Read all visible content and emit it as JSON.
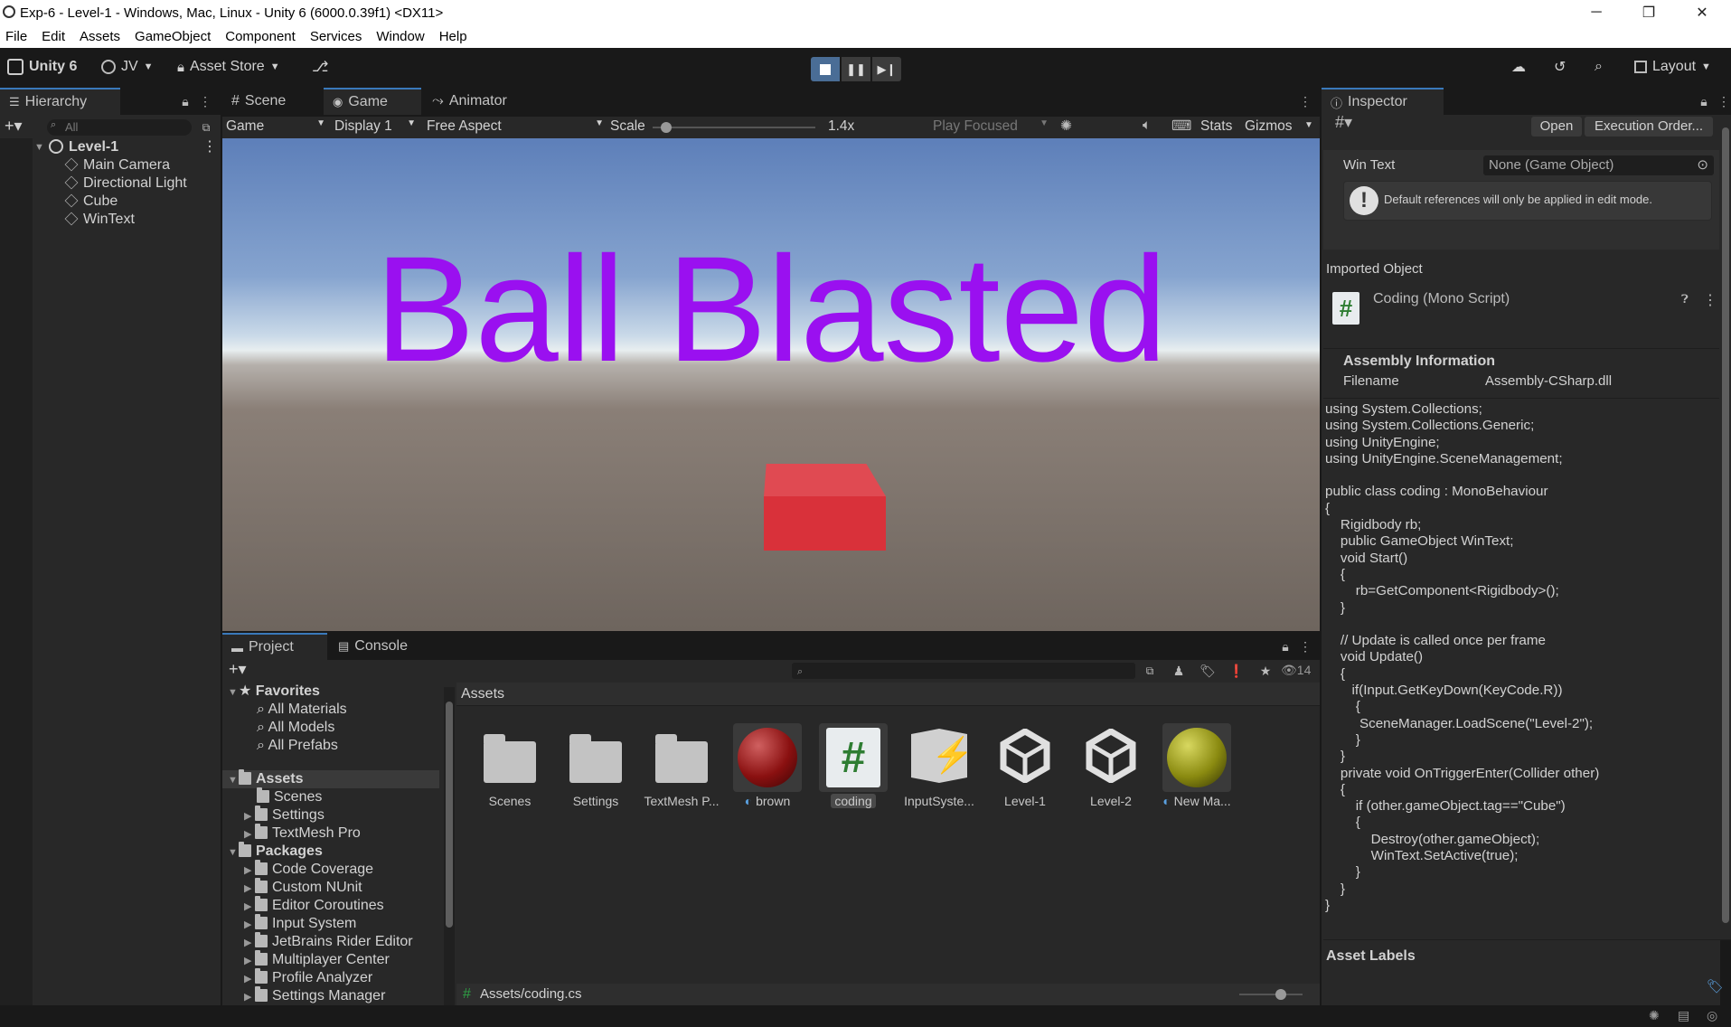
{
  "window": {
    "title": "Exp-6 - Level-1 - Windows, Mac, Linux - Unity 6 (6000.0.39f1) <DX11>",
    "minimize": "─",
    "maximize": "❐",
    "close": "✕"
  },
  "menu": [
    "File",
    "Edit",
    "Assets",
    "GameObject",
    "Component",
    "Services",
    "Window",
    "Help"
  ],
  "toolbar": {
    "unity_label": "Unity 6",
    "account": "JV",
    "asset_store": "Asset Store",
    "layout": "Layout"
  },
  "hierarchy": {
    "tab": "Hierarchy",
    "search_placeholder": "All",
    "scene": "Level-1",
    "items": [
      "Main Camera",
      "Directional Light",
      "Cube",
      "WinText"
    ]
  },
  "scene_tabs": [
    "Scene",
    "Game",
    "Animator"
  ],
  "game_bar": {
    "mode": "Game",
    "display": "Display 1",
    "aspect": "Free Aspect",
    "scale_label": "Scale",
    "scale_value": "1.4x",
    "scale_fraction": 0.05,
    "play_focused": "Play Focused",
    "stats": "Stats",
    "gizmos": "Gizmos"
  },
  "game_view": {
    "banner_text": "Ball Blasted",
    "banner_color": "#9a10f0",
    "cube_color": "#d9313a"
  },
  "project": {
    "tabs": [
      "Project",
      "Console"
    ],
    "hidden_count": "14",
    "favorites_label": "Favorites",
    "favorites": [
      "All Materials",
      "All Models",
      "All Prefabs"
    ],
    "assets_label": "Assets",
    "assets_children": [
      "Scenes",
      "Settings",
      "TextMesh Pro"
    ],
    "packages_label": "Packages",
    "packages": [
      "Code Coverage",
      "Custom NUnit",
      "Editor Coroutines",
      "Input System",
      "JetBrains Rider Editor",
      "Multiplayer Center",
      "Profile Analyzer",
      "Settings Manager"
    ],
    "breadcrumb": "Assets",
    "grid_items": [
      "Scenes",
      "Settings",
      "TextMesh P...",
      "brown",
      "coding",
      "InputSyste...",
      "Level-1",
      "Level-2",
      "New Ma..."
    ],
    "footer_path": "Assets/coding.cs"
  },
  "inspector": {
    "tab": "Inspector",
    "open_button": "Open",
    "execution_order_button": "Execution Order...",
    "win_text_label": "Win Text",
    "win_text_value": "None (Game Object)",
    "warning": "Default references will only be applied in edit mode.",
    "imported_object": "Imported Object",
    "script_title": "Coding (Mono Script)",
    "assembly_info": "Assembly Information",
    "filename_label": "Filename",
    "filename_value": "Assembly-CSharp.dll",
    "code": "using System.Collections;\nusing System.Collections.Generic;\nusing UnityEngine;\nusing UnityEngine.SceneManagement;\n\npublic class coding : MonoBehaviour\n{\n    Rigidbody rb;\n    public GameObject WinText;\n    void Start()\n    {\n        rb=GetComponent<Rigidbody>();\n    }\n\n    // Update is called once per frame\n    void Update()\n    {\n       if(Input.GetKeyDown(KeyCode.R))\n        {\n         SceneManager.LoadScene(\"Level-2\");\n        }\n    }\n    private void OnTriggerEnter(Collider other)\n    {\n        if (other.gameObject.tag==\"Cube\")\n        {\n            Destroy(other.gameObject);\n            WinText.SetActive(true);\n        }\n    }\n}",
    "asset_labels": "Asset Labels"
  }
}
